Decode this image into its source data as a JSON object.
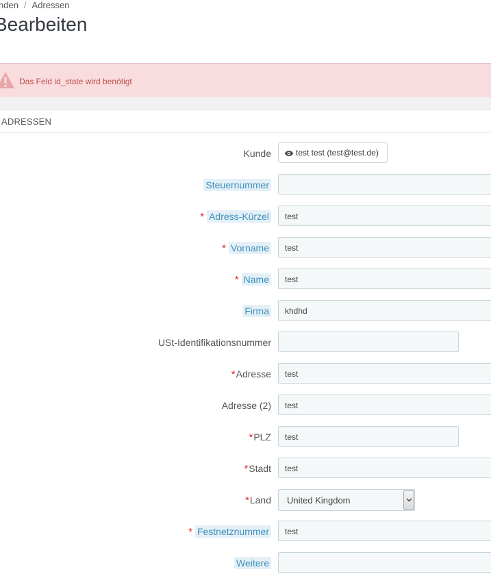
{
  "breadcrumb": {
    "parent": "nden",
    "current": "Adressen"
  },
  "page_title": "Bearbeiten",
  "alert": {
    "message": "Das Feld id_state wird benötigt",
    "icon": "warning-icon"
  },
  "panel": {
    "title": "ADRESSEN"
  },
  "colors": {
    "required": "#e0252e",
    "hint_text": "#3f8fbd",
    "alert_bg": "#f9dcdd"
  },
  "form": {
    "customer": {
      "label": "Kunde",
      "value": "test test (test@test.de)"
    },
    "tax_number": {
      "label": "Steuernummer",
      "value": ""
    },
    "alias": {
      "label": "Adress-Kürzel",
      "value": "test"
    },
    "firstname": {
      "label": "Vorname",
      "value": "test"
    },
    "lastname": {
      "label": "Name",
      "value": "test"
    },
    "company": {
      "label": "Firma",
      "value": "khdhd"
    },
    "vat_number": {
      "label": "USt-Identifikationsnummer",
      "value": ""
    },
    "address1": {
      "label": "Adresse",
      "value": "test"
    },
    "address2": {
      "label": "Adresse (2)",
      "value": "test"
    },
    "postcode": {
      "label": "PLZ",
      "value": "test"
    },
    "city": {
      "label": "Stadt",
      "value": "test"
    },
    "country": {
      "label": "Land",
      "value": "United Kingdom"
    },
    "phone": {
      "label": "Festnetznummer",
      "value": "test"
    },
    "other": {
      "label": "Weitere",
      "value": ""
    }
  }
}
